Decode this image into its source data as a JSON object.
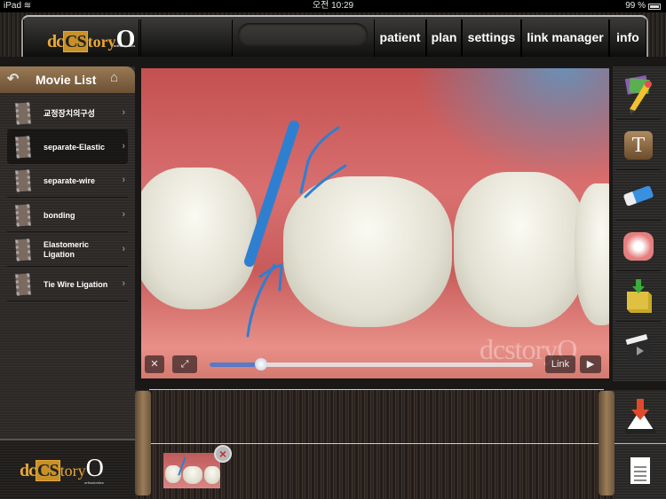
{
  "status_bar": {
    "device": "iPad",
    "time": "오전 10:29",
    "battery": "99 %"
  },
  "brand": {
    "logo_prefix": "dc",
    "logo_highlight": "CS",
    "logo_story": "tory",
    "logo_o": "O",
    "logo_sub": "orthodontics"
  },
  "top_nav": {
    "items": [
      {
        "label": "patient"
      },
      {
        "label": "plan"
      },
      {
        "label": "settings"
      },
      {
        "label": "link manager"
      },
      {
        "label": "info"
      }
    ]
  },
  "movie_list": {
    "title": "Movie List",
    "items": [
      {
        "label": "교정장치의구성",
        "selected": false
      },
      {
        "label": "separate-Elastic",
        "selected": true
      },
      {
        "label": "separate-wire",
        "selected": false
      },
      {
        "label": "bonding",
        "selected": false
      },
      {
        "label": "Elastomeric Ligation",
        "selected": false
      },
      {
        "label": "Tie Wire Ligation",
        "selected": false
      }
    ]
  },
  "player": {
    "progress_fraction": 0.16,
    "link_label": "Link",
    "watermark": "dcstoryO"
  },
  "tools": [
    "palette-pencil",
    "text",
    "eraser",
    "dentition-model",
    "import-box",
    "movie-clapper"
  ],
  "bottom": {
    "thumbnail_count": 1
  },
  "colors": {
    "accent_orange": "#e8a838",
    "annotation_blue": "#2f7fd0",
    "slider_blue": "#5a79c8"
  }
}
